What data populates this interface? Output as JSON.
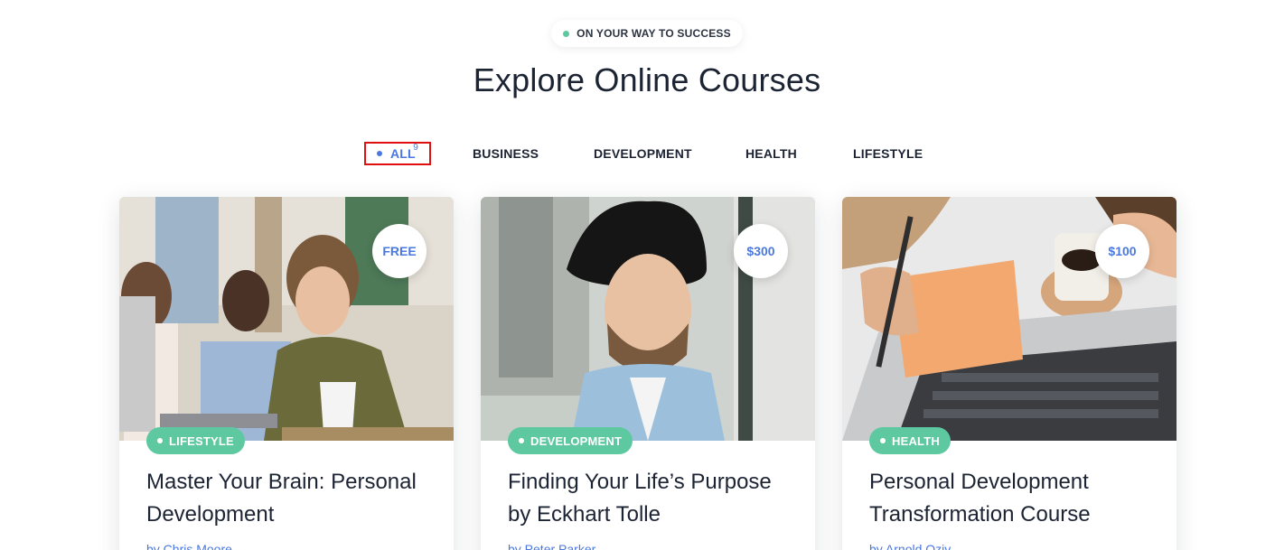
{
  "header": {
    "eyebrow": "ON YOUR WAY TO SUCCESS",
    "title": "Explore Online Courses"
  },
  "filters": {
    "all_label": "ALL",
    "all_count": "9",
    "items": [
      "BUSINESS",
      "DEVELOPMENT",
      "HEALTH",
      "LIFESTYLE"
    ]
  },
  "courses": [
    {
      "price": "FREE",
      "category": "LIFESTYLE",
      "title": "Master Your Brain: Personal Development",
      "author": "by Chris Moore"
    },
    {
      "price": "$300",
      "category": "DEVELOPMENT",
      "title": "Finding Your Life’s Purpose by Eckhart Tolle",
      "author": "by Peter Parker"
    },
    {
      "price": "$100",
      "category": "HEALTH",
      "title": "Personal Development Transformation Course",
      "author": "by Arnold Oziv"
    }
  ],
  "colors": {
    "accent": "#4a78e0",
    "category_badge": "#5ec9a0",
    "active_outline": "#e01010",
    "heading": "#1c2434"
  }
}
